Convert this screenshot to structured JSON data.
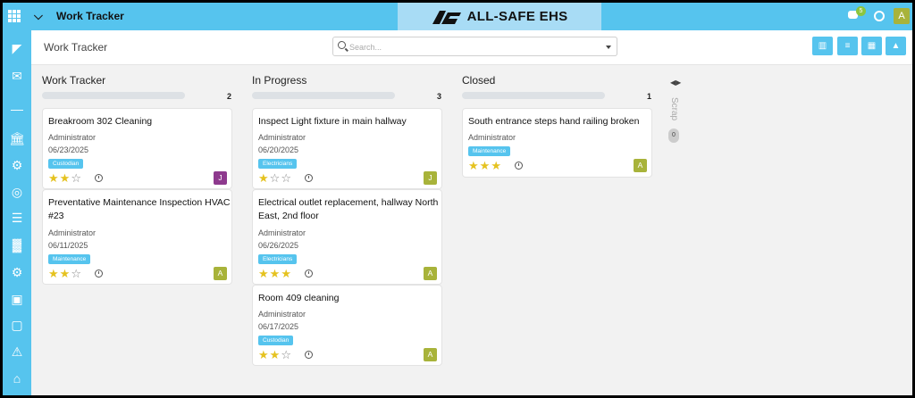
{
  "app": {
    "title": "Work Tracker",
    "brand": "ALL-SAFE EHS",
    "chat_badge": "5",
    "user_initial": "A"
  },
  "subheader": {
    "title": "Work Tracker",
    "search_placeholder": "Search..."
  },
  "sidebar_icons": [
    "logo-icon",
    "inbox-icon",
    "minus-icon",
    "building-icon",
    "gears-icon",
    "target-icon",
    "report-icon",
    "chart-icon",
    "gear-icon",
    "id-card-icon",
    "monitor-icon",
    "alert-icon",
    "bank-icon"
  ],
  "columns": [
    {
      "name": "Work Tracker",
      "count": "2",
      "cards": [
        {
          "title": "Breakroom 302 Cleaning",
          "owner": "Administrator",
          "date": "06/23/2025",
          "tag": "Custodian",
          "stars": 2,
          "avatar": "J",
          "avatar_color": "#8e3a8e"
        },
        {
          "title": "Preventative Maintenance Inspection HVAC #23",
          "owner": "Administrator",
          "date": "06/11/2025",
          "tag": "Maintenance",
          "stars": 2,
          "avatar": "A",
          "avatar_color": "#a8b33a"
        }
      ]
    },
    {
      "name": "In Progress",
      "count": "3",
      "cards": [
        {
          "title": "Inspect Light fixture in main hallway",
          "owner": "Administrator",
          "date": "06/20/2025",
          "tag": "Electricians",
          "stars": 1,
          "avatar": "J",
          "avatar_color": "#a8b33a"
        },
        {
          "title": "Electrical outlet replacement, hallway North East, 2nd floor",
          "owner": "Administrator",
          "date": "06/26/2025",
          "tag": "Electricians",
          "stars": 3,
          "avatar": "A",
          "avatar_color": "#a8b33a"
        },
        {
          "title": "Room 409 cleaning",
          "owner": "Administrator",
          "date": "06/17/2025",
          "tag": "Custodian",
          "stars": 2,
          "avatar": "A",
          "avatar_color": "#a8b33a"
        }
      ]
    },
    {
      "name": "Closed",
      "count": "1",
      "cards": [
        {
          "title": "South entrance steps hand railing broken",
          "owner": "Administrator",
          "date": "",
          "tag": "Maintenance",
          "stars": 3,
          "avatar": "A",
          "avatar_color": "#a8b33a"
        }
      ]
    }
  ],
  "scrap": {
    "label": "Scrap",
    "count": "0"
  },
  "colors": {
    "accent": "#56c4ee",
    "brand_bg": "#a8dcf5",
    "star": "#e5c21f"
  }
}
